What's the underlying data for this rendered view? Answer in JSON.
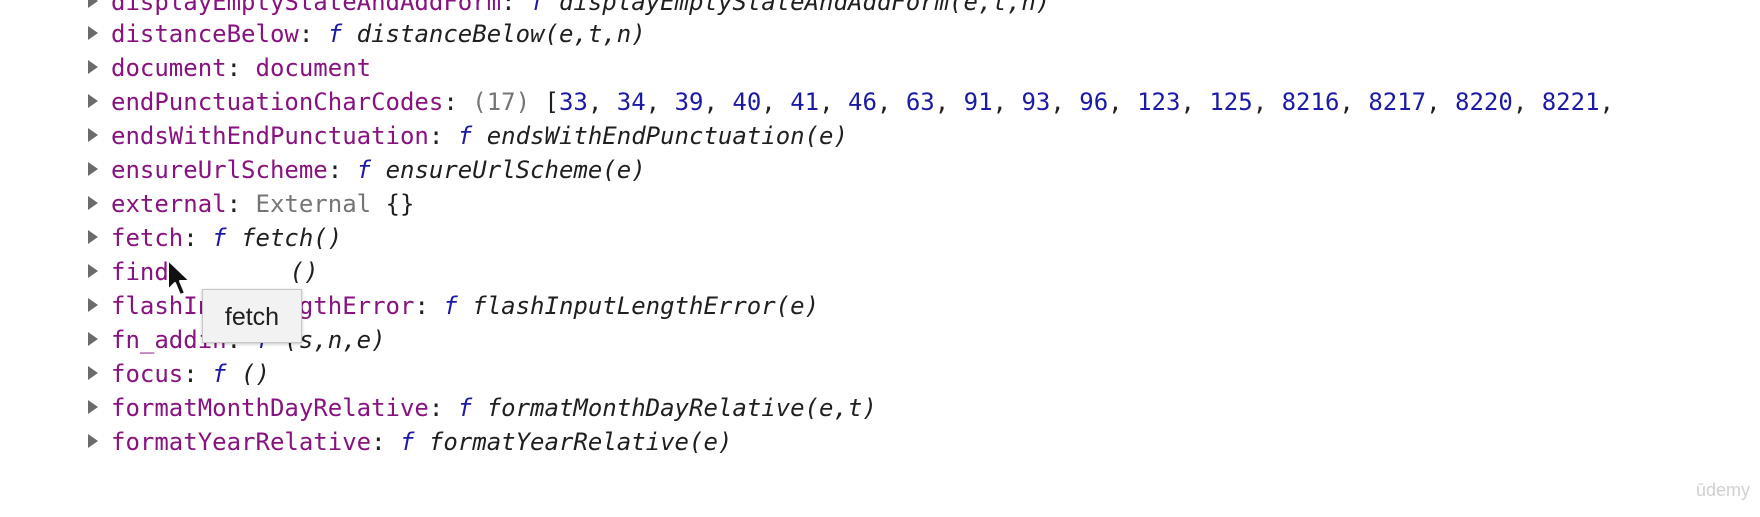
{
  "rows": [
    {
      "key": "displayEmptyStateAndAddForm",
      "sep": ":",
      "f": "f",
      "sig": "displayEmptyStateAndAddForm(e,t,n)"
    },
    {
      "key": "distanceBelow",
      "sep": ":",
      "f": "f",
      "sig": "distanceBelow(e,t,n)"
    },
    {
      "key": "document",
      "sep": ":",
      "value": "document"
    },
    {
      "key": "endPunctuationCharCodes",
      "sep": ":",
      "count": "(17)",
      "open": "[",
      "values": [
        "33",
        "34",
        "39",
        "40",
        "41",
        "46",
        "63",
        "91",
        "93",
        "96",
        "123",
        "125",
        "8216",
        "8217",
        "8220",
        "8221"
      ]
    },
    {
      "key": "endsWithEndPunctuation",
      "sep": ":",
      "f": "f",
      "sig": "endsWithEndPunctuation(e)"
    },
    {
      "key": "ensureUrlScheme",
      "sep": ":",
      "f": "f",
      "sig": "ensureUrlScheme(e)"
    },
    {
      "key": "external",
      "sep": ":",
      "cls": "External",
      "braces": "{}"
    },
    {
      "key": "fetch",
      "sep": ":",
      "f": "f",
      "sig": "fetch()"
    },
    {
      "key": "find",
      "sep": ":",
      "sig": "()"
    },
    {
      "key": "flashInputLengthError",
      "sep": ":",
      "f": "f",
      "sig": "flashInputLengthError(e)"
    },
    {
      "key": "fn_addin",
      "sep": ":",
      "f": "f",
      "sig": "(s,n,e)"
    },
    {
      "key": "focus",
      "sep": ":",
      "f": "f",
      "sig": "()"
    },
    {
      "key": "formatMonthDayRelative",
      "sep": ":",
      "f": "f",
      "sig": "formatMonthDayRelative(e,t)"
    },
    {
      "key": "formatYearRelative",
      "sep": ":",
      "f": "f",
      "sig": "formatYearRelative(e)"
    }
  ],
  "tooltip": {
    "text": "fetch"
  },
  "watermark": "ūdemy"
}
